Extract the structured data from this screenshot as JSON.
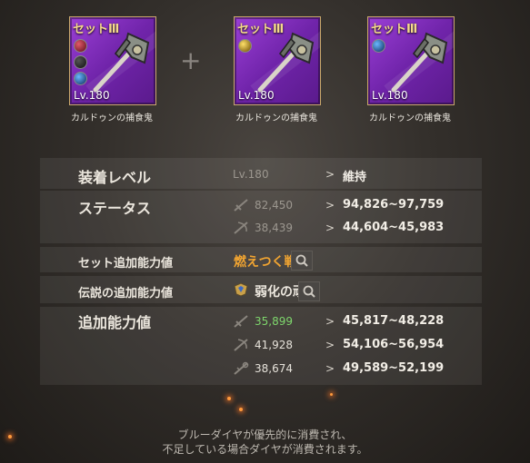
{
  "items": [
    {
      "set_label": "セット",
      "level": "Lv.180",
      "name": "カルドゥンの捕食鬼",
      "gems": [
        "red",
        "dark",
        "blue"
      ]
    },
    {
      "set_label": "セット",
      "level": "Lv.180",
      "name": "カルドゥンの捕食鬼",
      "gems": [
        "yellow"
      ]
    },
    {
      "set_label": "セット",
      "level": "Lv.180",
      "name": "カルドゥンの捕食鬼",
      "gems": [
        "blue"
      ]
    }
  ],
  "plus_symbol": "+",
  "arrow_symbol": ">",
  "equip_level": {
    "label": "装着レベル",
    "current": "Lv.180",
    "result": "維持"
  },
  "status": {
    "label": "ステータス",
    "rows": [
      {
        "icon": "sword-icon",
        "current": "82,450",
        "result": "94,826~97,759"
      },
      {
        "icon": "bow-icon",
        "current": "38,439",
        "result": "44,604~45,983"
      }
    ]
  },
  "set_bonus": {
    "label": "セット追加能力値",
    "value": "燃えつく戦意"
  },
  "legend_bonus": {
    "label": "伝説の追加能力値",
    "value": "弱化の頑強"
  },
  "extra": {
    "label": "追加能力値",
    "rows": [
      {
        "icon": "sword-icon",
        "current": "35,899",
        "result": "45,817~48,228",
        "color": "#7ed66c"
      },
      {
        "icon": "bow-icon",
        "current": "41,928",
        "result": "54,106~56,954",
        "color": "#e6e2da"
      },
      {
        "icon": "magic-icon",
        "current": "38,674",
        "result": "49,589~52,199",
        "color": "#e6e2da"
      }
    ]
  },
  "footer": {
    "line1": "ブルーダイヤが優先的に消費され、",
    "line2": "不足している場合ダイヤが消費されます。"
  }
}
